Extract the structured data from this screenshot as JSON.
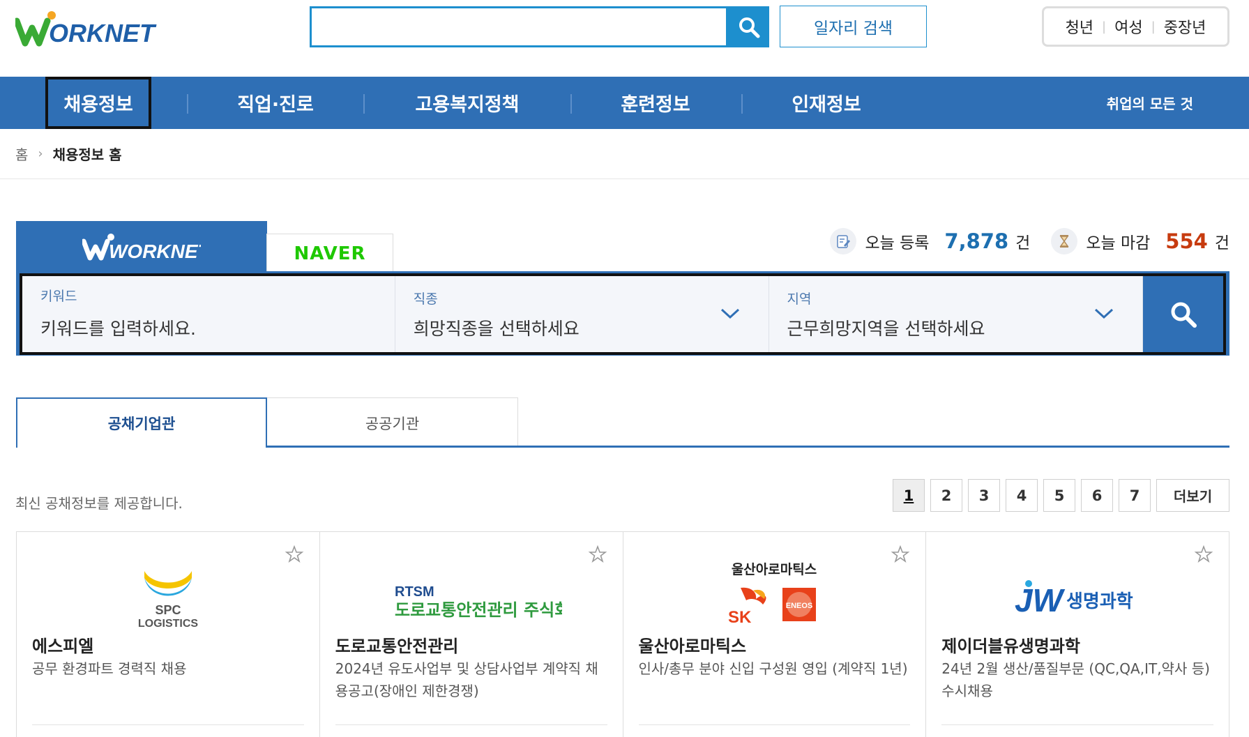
{
  "header": {
    "logo_text": "WORKNET",
    "search_value": "",
    "job_search_label": "일자리 검색",
    "quick_links": [
      "청년",
      "여성",
      "중장년"
    ]
  },
  "gnb": {
    "items": [
      "채용정보",
      "직업·진로",
      "고용복지정책",
      "훈련정보",
      "인재정보"
    ],
    "active_index": 0,
    "right_label": "취업의 모든 것"
  },
  "breadcrumb": {
    "home": "홈",
    "current": "채용정보 홈"
  },
  "search_panel": {
    "tabs": {
      "worknet": "WORKNET",
      "naver": "NAVER"
    },
    "stats": {
      "today_registered_label": "오늘 등록",
      "today_registered_value": "7,878",
      "today_deadline_label": "오늘 마감",
      "today_deadline_value": "554",
      "unit": "건"
    },
    "fields": [
      {
        "label": "키워드",
        "value": "키워드를 입력하세요."
      },
      {
        "label": "직종",
        "value": "희망직종을 선택하세요"
      },
      {
        "label": "지역",
        "value": "근무희망지역을 선택하세요"
      }
    ]
  },
  "category_tabs": {
    "active": "공채기업관",
    "inactive": "공공기관"
  },
  "list": {
    "description": "최신 공채정보를 제공합니다.",
    "pages": [
      "1",
      "2",
      "3",
      "4",
      "5",
      "6",
      "7"
    ],
    "current_page": "1",
    "more_label": "더보기"
  },
  "cards": [
    {
      "company": "에스피엘",
      "title": "공무 환경파트 경력직 채용",
      "logo_lines": [
        "SPC",
        "LOGISTICS"
      ]
    },
    {
      "company": "도로교통안전관리",
      "title": "2024년 유도사업부 및 상담사업부 계약직 채용공고(장애인 제한경쟁)",
      "logo_lines": [
        "RTSM",
        "도로교통안전관리 주식회사"
      ]
    },
    {
      "company": "울산아로마틱스",
      "title": "인사/총무 분야 신입 구성원 영입 (계약직 1년)",
      "logo_lines": [
        "울산아로마틱스",
        "SK",
        "ENEOS"
      ]
    },
    {
      "company": "제이더블유생명과학",
      "title": "24년 2월 생산/품질부문 (QC,QA,IT,약사 등) 수시채용",
      "logo_lines": [
        "JW",
        "생명과학"
      ]
    }
  ],
  "colors": {
    "brand_blue": "#2f6fb5",
    "search_blue": "#1d8fce",
    "logo_green": "#3aaa35",
    "logo_orange": "#f5a623",
    "logo_navy": "#1f5fa8"
  }
}
